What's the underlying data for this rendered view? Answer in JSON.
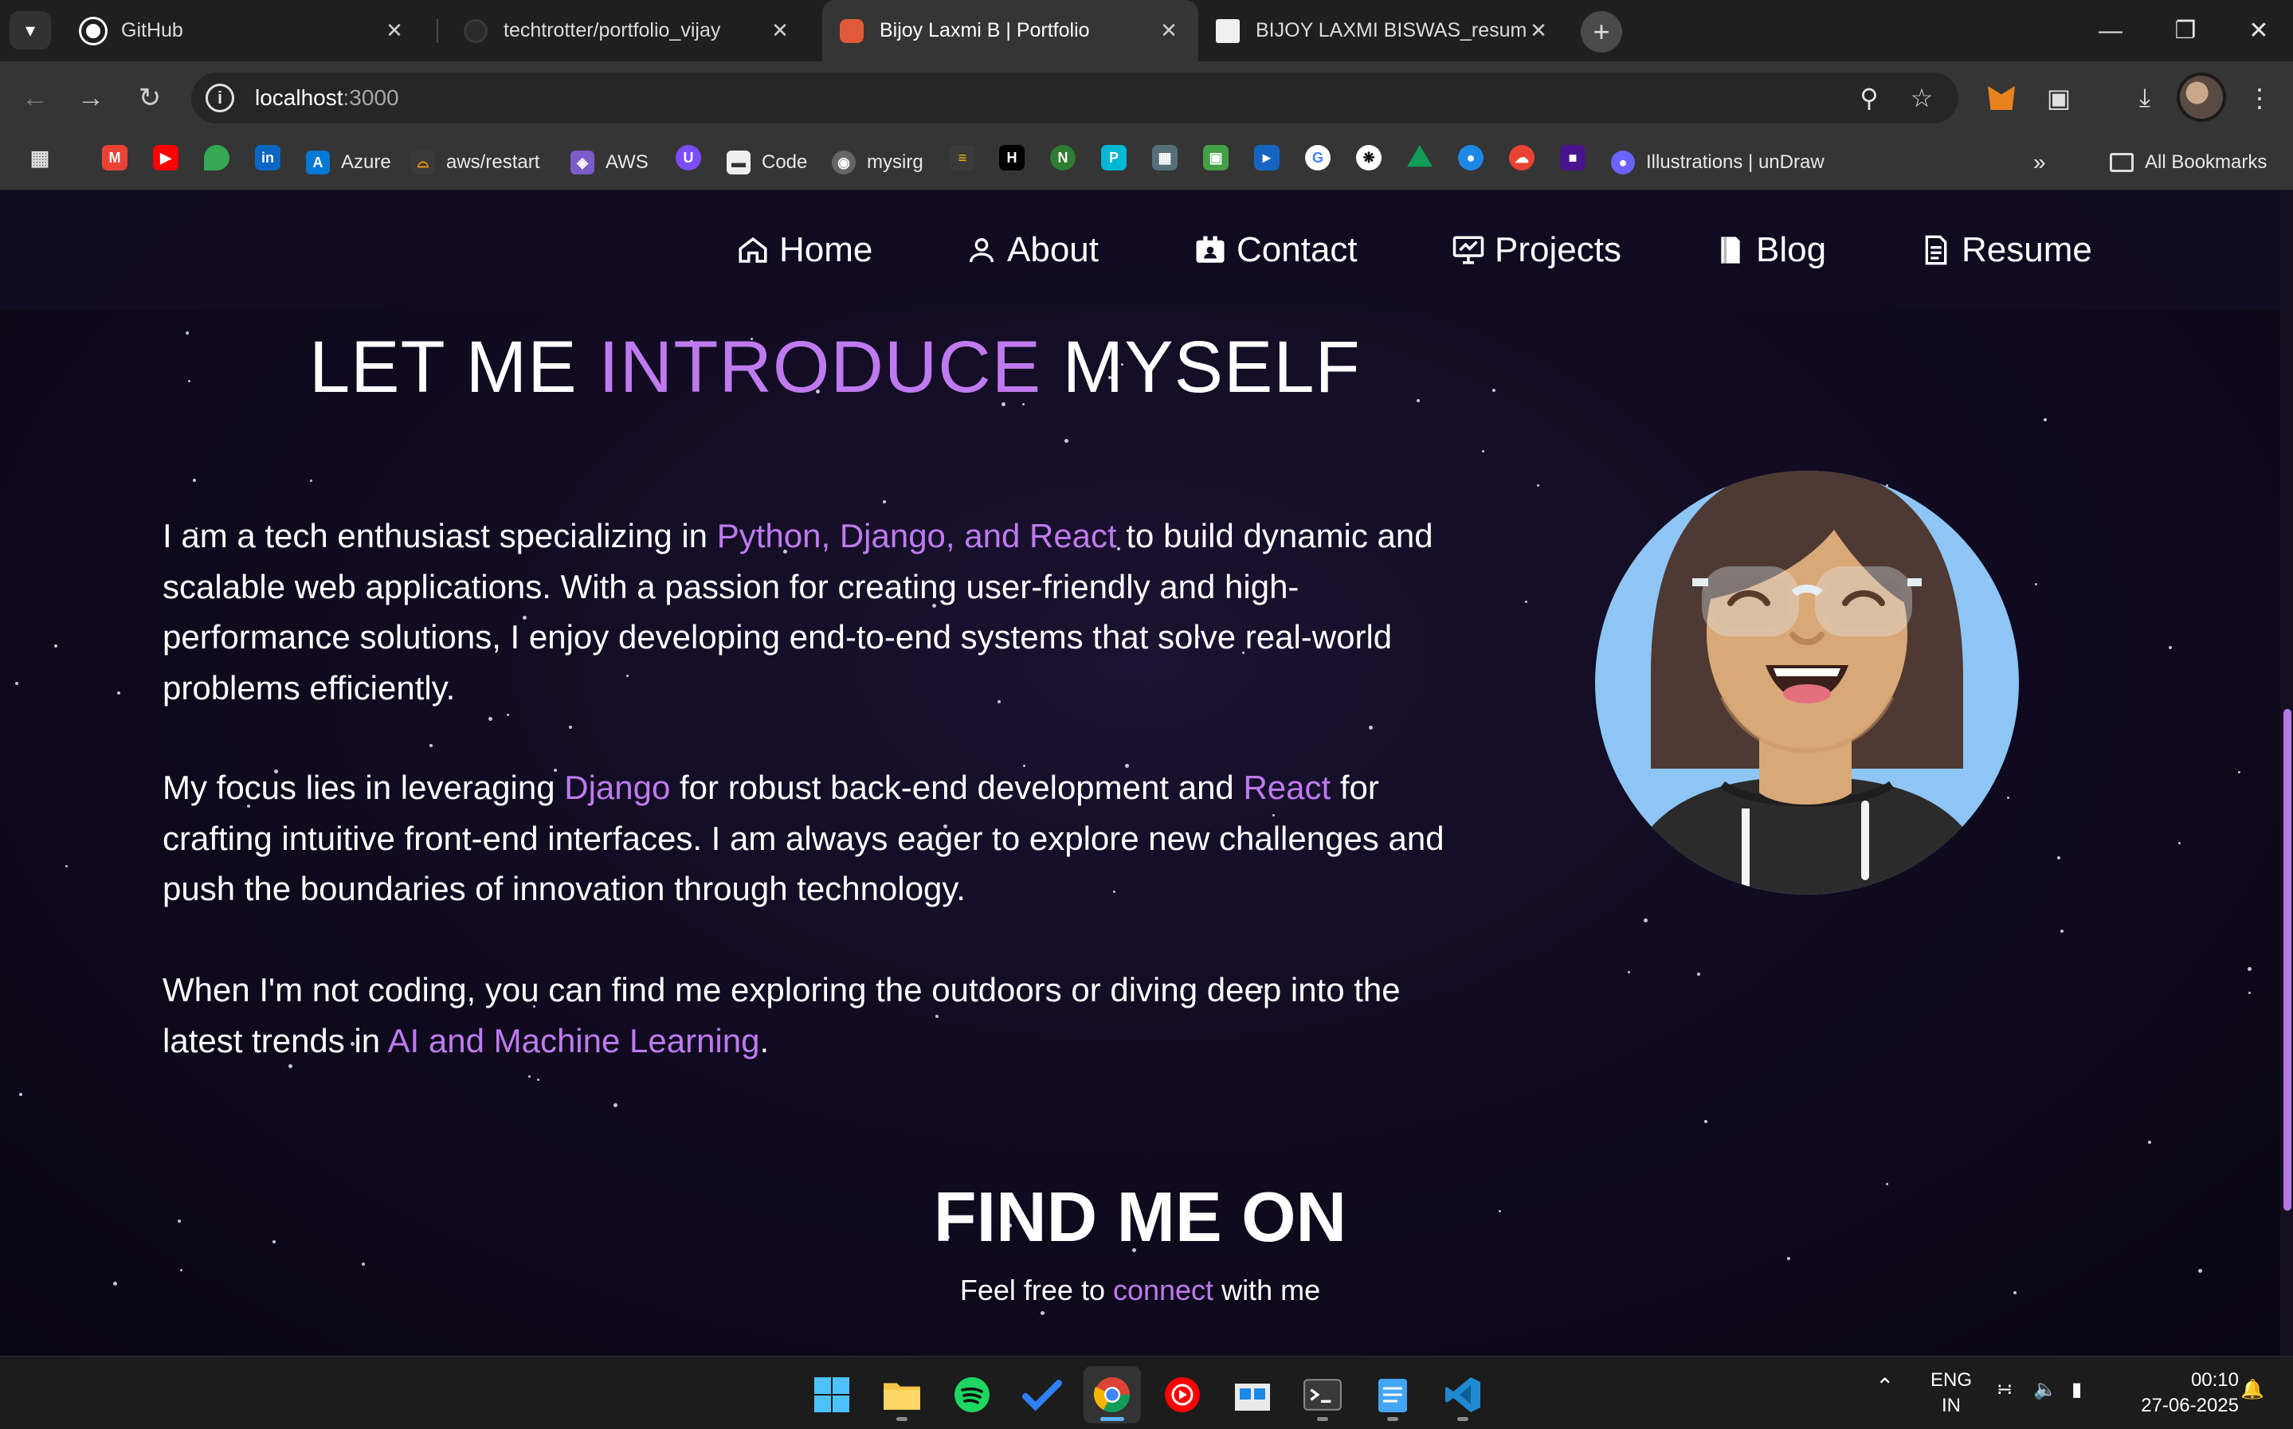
{
  "browser": {
    "tabs": [
      {
        "title": "GitHub",
        "active": false
      },
      {
        "title": "techtrotter/portfolio_vijay",
        "active": false
      },
      {
        "title": "Bijoy Laxmi B | Portfolio",
        "active": true
      },
      {
        "title": "BIJOY LAXMI BISWAS_resume.d",
        "active": false
      }
    ],
    "url_host": "localhost",
    "url_port": ":3000",
    "bookmarks": [
      {
        "label": "Azure",
        "icon": "azure-icon"
      },
      {
        "label": "aws/restart",
        "icon": "aws-restart-icon"
      },
      {
        "label": "AWS",
        "icon": "aws-icon"
      },
      {
        "label": "Code",
        "icon": "code-icon"
      },
      {
        "label": "mysirg",
        "icon": "mysirg-icon"
      },
      {
        "label": "Illustrations | unDraw",
        "icon": "undraw-icon"
      }
    ],
    "all_bookmarks": "All Bookmarks"
  },
  "nav": {
    "home": "Home",
    "about": "About",
    "contact": "Contact",
    "projects": "Projects",
    "blog": "Blog",
    "resume": "Resume"
  },
  "about": {
    "heading_a": "LET ME ",
    "heading_b": "INTRODUCE",
    "heading_c": " MYSELF",
    "p1_a": "I am a tech enthusiast specializing in ",
    "p1_hl": "Python, Django, and React",
    "p1_b": " to build dynamic and scalable web applications. With a passion for creating user-friendly and high-performance solutions, I enjoy developing end-to-end systems that solve real-world problems efficiently.",
    "p2_a": "My focus lies in leveraging ",
    "p2_hl1": "Django",
    "p2_b": " for robust back-end development and ",
    "p2_hl2": "React",
    "p2_c": " for crafting intuitive front-end interfaces. I am always eager to explore new challenges and push the boundaries of innovation through technology.",
    "p3_a": "When I'm not coding, you can find me exploring the outdoors or diving deep into the latest trends in ",
    "p3_hl": "AI and Machine Learning",
    "p3_b": "."
  },
  "find": {
    "title": "FIND ME ON",
    "sub_a": "Feel free to ",
    "sub_hl": "connect",
    "sub_b": " with me"
  },
  "taskbar": {
    "lang": "ENG",
    "region": "IN",
    "time": "00:10",
    "date": "27-06-2025"
  },
  "colors": {
    "accent": "#c07af0",
    "background": "#0f0a1e",
    "avatar_circle": "#8ec5f5"
  }
}
